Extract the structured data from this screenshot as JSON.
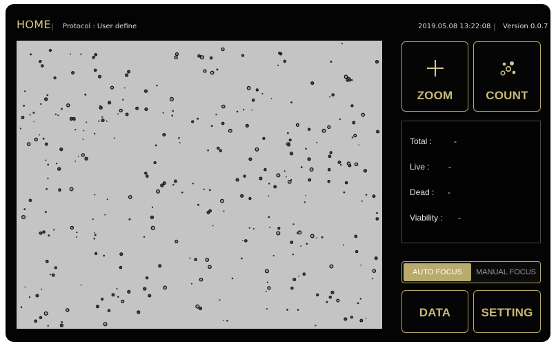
{
  "header": {
    "title": "HOME",
    "separator": "|",
    "protocol_label": "Protocol :",
    "protocol_value": "User define",
    "datetime": "2019.05.08 13:22:08",
    "version": "Version 0.0.7"
  },
  "actions": {
    "zoom_label": "ZOOM",
    "zoom_icon": "plus-icon",
    "count_label": "COUNT",
    "count_icon": "cells-icon"
  },
  "results": {
    "total_label": "Total :",
    "total_value": "-",
    "live_label": "Live :",
    "live_value": "-",
    "dead_label": "Dead :",
    "dead_value": "-",
    "viability_label": "Viability :",
    "viability_value": "-"
  },
  "focus": {
    "auto_label": "AUTO FOCUS",
    "manual_label": "MANUAL FOCUS",
    "selected": "AUTO FOCUS"
  },
  "footer": {
    "data_label": "DATA",
    "setting_label": "SETTING"
  },
  "colors": {
    "accent": "#b4a768",
    "accent_text": "#c8b978",
    "background": "#040404",
    "image_background": "#c4c4c4"
  }
}
